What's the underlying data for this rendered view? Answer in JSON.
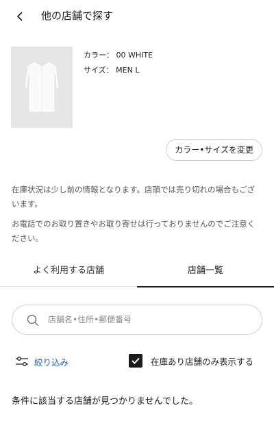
{
  "header": {
    "title": "他の店舗で探す",
    "back_icon": "chevron-left-icon"
  },
  "product": {
    "color_label": "カラー：",
    "color_value": "00 WHITE",
    "size_label": "サイズ：",
    "size_value": "MEN L",
    "change_button": "カラー•サイズを変更"
  },
  "notices": {
    "stock": "在庫状況は少し前の情報となります。店頭では売り切れの場合もございます。",
    "phone": "お電話でのお取り置きやお取り寄せは行っておりませんのでご注意ください。"
  },
  "tabs": [
    {
      "label": "よく利用する店舗",
      "active": false
    },
    {
      "label": "店舗一覧",
      "active": true
    }
  ],
  "search": {
    "placeholder": "店舗名•住所•郵便番号"
  },
  "filter": {
    "label": "絞り込み",
    "color": "#1b5fa8"
  },
  "in_stock_toggle": {
    "label": "在庫あり店舗のみ表示する",
    "checked": true
  },
  "empty_message": "条件に該当する店舗が見つかりませんでした。"
}
